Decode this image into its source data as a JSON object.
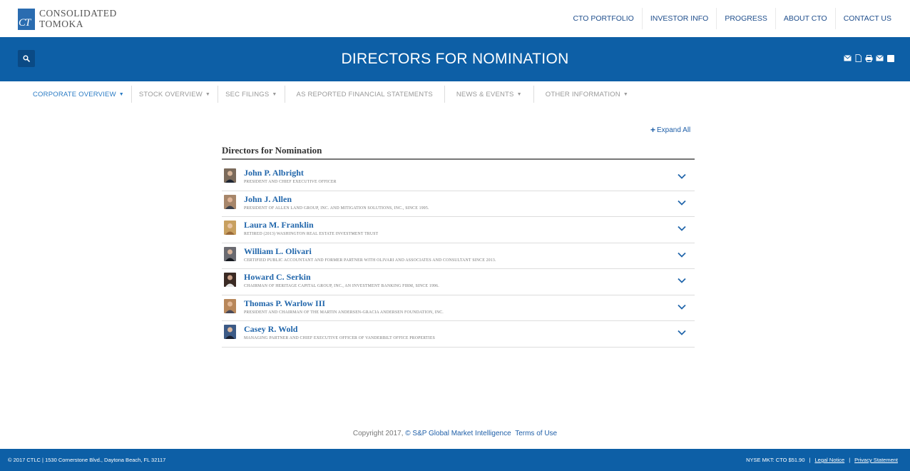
{
  "header": {
    "logo_line1": "CONSOLIDATED",
    "logo_line2": "TOMOKA",
    "logo_mark": "CT",
    "nav": [
      "CTO PORTFOLIO",
      "INVESTOR INFO",
      "PROGRESS",
      "ABOUT CTO",
      "CONTACT US"
    ]
  },
  "banner": {
    "title": "DIRECTORS FOR NOMINATION",
    "search_icon": "search-icon",
    "tools": [
      "email-alert-icon",
      "document-icon",
      "print-icon",
      "email-icon",
      "rss-icon"
    ]
  },
  "subnav": [
    {
      "label": "CORPORATE OVERVIEW",
      "caret": "▼"
    },
    {
      "label": "STOCK OVERVIEW",
      "caret": "▼"
    },
    {
      "label": "SEC FILINGS",
      "caret": "▼"
    },
    {
      "label": "AS REPORTED FINANCIAL STATEMENTS",
      "caret": ""
    },
    {
      "label": "NEWS & EVENTS",
      "caret": "▼"
    },
    {
      "label": "OTHER INFORMATION",
      "caret": "▼"
    }
  ],
  "content": {
    "expand_all": "Expand All",
    "section_title": "Directors for Nomination",
    "directors": [
      {
        "name": "John P. Albright",
        "role": "PRESIDENT AND CHIEF EXECUTIVE OFFICER"
      },
      {
        "name": "John J. Allen",
        "role": "PRESIDENT OF ALLEN LAND GROUP, INC. AND MITIGATION SOLUTIONS, INC., SINCE 1995."
      },
      {
        "name": "Laura M. Franklin",
        "role": "RETIRED (2013) WASHINGTON REAL ESTATE INVESTMENT TRUST"
      },
      {
        "name": "William L. Olivari",
        "role": "CERTIFIED PUBLIC ACCOUNTANT AND FORMER PARTNER WITH OLIVARI AND ASSOCIATES AND CONSULTANT SINCE 2013."
      },
      {
        "name": "Howard C. Serkin",
        "role": "CHAIRMAN OF HERITAGE CAPITAL GROUP, INC., AN INVESTMENT BANKING FIRM, SINCE 1996."
      },
      {
        "name": "Thomas P. Warlow III",
        "role": "PRESIDENT AND CHAIRMAN OF THE MARTIN ANDERSEN-GRACIA ANDERSEN FOUNDATION, INC."
      },
      {
        "name": "Casey R. Wold",
        "role": "MANAGING PARTNER AND CHIEF EXECUTIVE OFFICER OF VANDERBILT OFFICE PROPERTIES"
      }
    ]
  },
  "copyright": {
    "text": "Copyright 2017, ",
    "provider": "© S&P Global Market Intelligence",
    "terms": "Terms of Use"
  },
  "footer": {
    "address": "© 2017 CTLC | 1530 Cornerstone Blvd., Daytona Beach, FL 32117",
    "quote": "NYSE MKT: CTO $51.90",
    "legal": "Legal Notice",
    "privacy": "Privacy Statement",
    "separator": "|"
  },
  "colors": {
    "brand_blue": "#0d5fa6",
    "link_blue": "#2166ab",
    "active_nav": "#2a7bc4"
  }
}
